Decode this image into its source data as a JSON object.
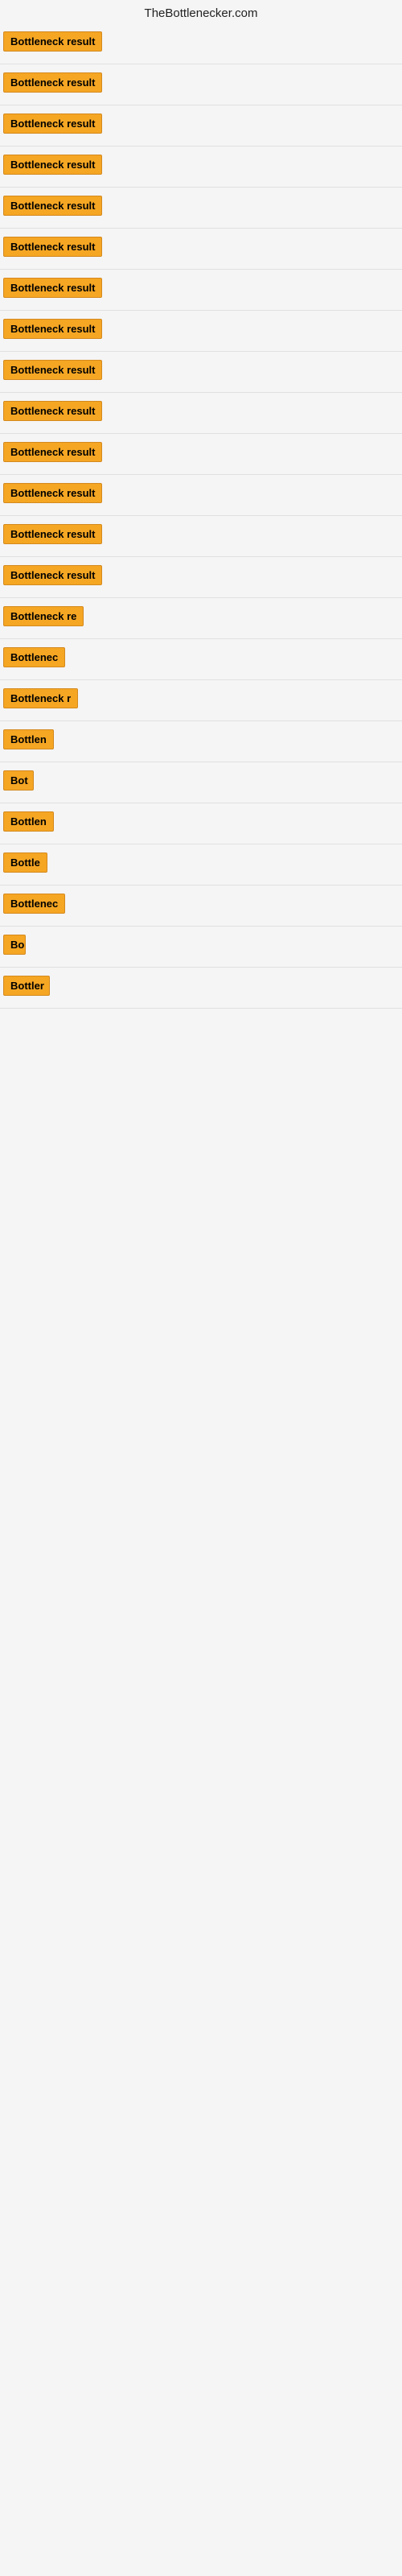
{
  "header": {
    "title": "TheBottlenecker.com"
  },
  "results": [
    {
      "id": 1,
      "label": "Bottleneck result",
      "width": 170
    },
    {
      "id": 2,
      "label": "Bottleneck result",
      "width": 170
    },
    {
      "id": 3,
      "label": "Bottleneck result",
      "width": 170
    },
    {
      "id": 4,
      "label": "Bottleneck result",
      "width": 170
    },
    {
      "id": 5,
      "label": "Bottleneck result",
      "width": 170
    },
    {
      "id": 6,
      "label": "Bottleneck result",
      "width": 170
    },
    {
      "id": 7,
      "label": "Bottleneck result",
      "width": 170
    },
    {
      "id": 8,
      "label": "Bottleneck result",
      "width": 170
    },
    {
      "id": 9,
      "label": "Bottleneck result",
      "width": 170
    },
    {
      "id": 10,
      "label": "Bottleneck result",
      "width": 170
    },
    {
      "id": 11,
      "label": "Bottleneck result",
      "width": 170
    },
    {
      "id": 12,
      "label": "Bottleneck result",
      "width": 170
    },
    {
      "id": 13,
      "label": "Bottleneck result",
      "width": 170
    },
    {
      "id": 14,
      "label": "Bottleneck result",
      "width": 170
    },
    {
      "id": 15,
      "label": "Bottleneck re",
      "width": 110
    },
    {
      "id": 16,
      "label": "Bottlenec",
      "width": 85
    },
    {
      "id": 17,
      "label": "Bottleneck r",
      "width": 95
    },
    {
      "id": 18,
      "label": "Bottlen",
      "width": 68
    },
    {
      "id": 19,
      "label": "Bot",
      "width": 38
    },
    {
      "id": 20,
      "label": "Bottlen",
      "width": 68
    },
    {
      "id": 21,
      "label": "Bottle",
      "width": 58
    },
    {
      "id": 22,
      "label": "Bottlenec",
      "width": 80
    },
    {
      "id": 23,
      "label": "Bo",
      "width": 28
    },
    {
      "id": 24,
      "label": "Bottler",
      "width": 58
    }
  ]
}
